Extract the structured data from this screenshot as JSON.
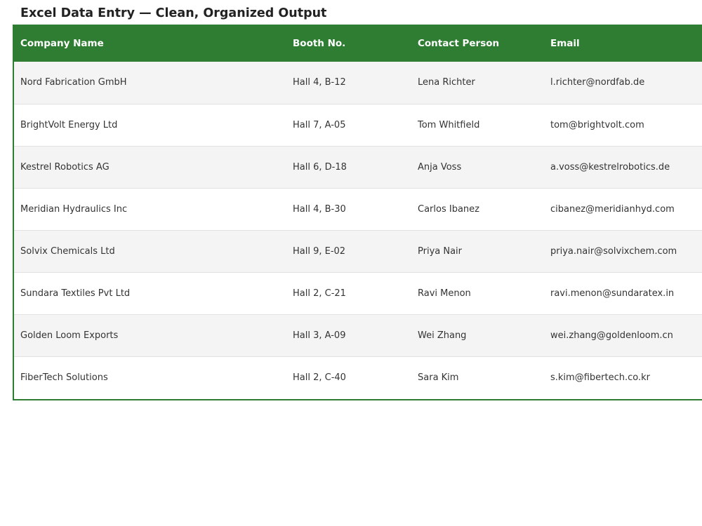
{
  "page": {
    "title": "Excel Data Entry — Clean, Organized Output"
  },
  "colors": {
    "header_bg": "#2e7d32",
    "header_text": "#ffffff",
    "row_alt_bg": "#f4f4f4",
    "row_bg": "#ffffff",
    "frame_border": "#2e7d32"
  },
  "table": {
    "columns": [
      "Company Name",
      "Booth No.",
      "Contact Person",
      "Email"
    ],
    "rows": [
      [
        "Nord Fabrication GmbH",
        "Hall 4, B-12",
        "Lena Richter",
        "l.richter@nordfab.de"
      ],
      [
        "BrightVolt Energy Ltd",
        "Hall 7, A-05",
        "Tom Whitfield",
        "tom@brightvolt.com"
      ],
      [
        "Kestrel Robotics AG",
        "Hall 6, D-18",
        "Anja Voss",
        "a.voss@kestrelrobotics.de"
      ],
      [
        "Meridian Hydraulics Inc",
        "Hall 4, B-30",
        "Carlos Ibanez",
        "cibanez@meridianhyd.com"
      ],
      [
        "Solvix Chemicals Ltd",
        "Hall 9, E-02",
        "Priya Nair",
        "priya.nair@solvixchem.com"
      ],
      [
        "Sundara Textiles Pvt Ltd",
        "Hall 2, C-21",
        "Ravi Menon",
        "ravi.menon@sundaratex.in"
      ],
      [
        "Golden Loom Exports",
        "Hall 3, A-09",
        "Wei Zhang",
        "wei.zhang@goldenloom.cn"
      ],
      [
        "FiberTech Solutions",
        "Hall 2, C-40",
        "Sara Kim",
        "s.kim@fibertech.co.kr"
      ]
    ]
  }
}
